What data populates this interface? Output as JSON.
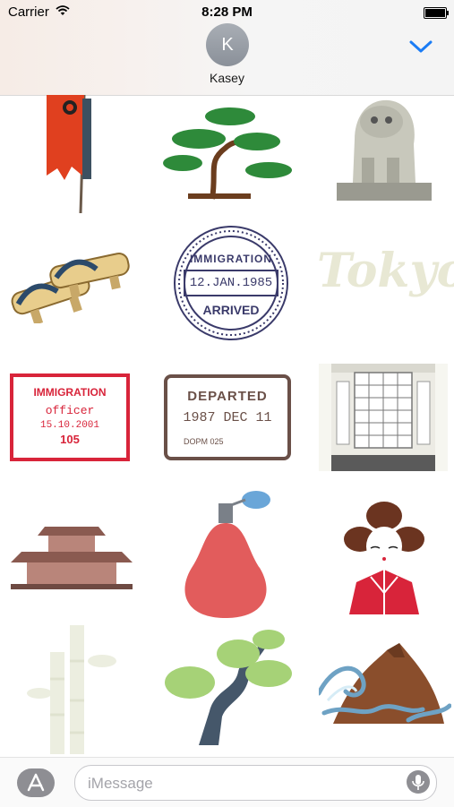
{
  "status_bar": {
    "carrier": "Carrier",
    "time": "8:28 PM"
  },
  "header": {
    "avatar_initial": "K",
    "contact_name": "Kasey",
    "chevron_icon": "chevron-down-icon",
    "accent_color": "#1a7cf5"
  },
  "stickers": {
    "stamp_immigration_arrived": {
      "line1": "IMMIGRATION",
      "date": "12.JAN.1985",
      "line2": "ARRIVED"
    },
    "tokyo_script": "Tokyo",
    "stamp_immigration_officer": {
      "line1": "IMMIGRATION",
      "line2": "officer",
      "date": "15.10.2001",
      "code": "105"
    },
    "stamp_departed": {
      "line1": "DEPARTED",
      "date": "1987 DEC 11",
      "code": "DOPM 025"
    }
  },
  "compose": {
    "placeholder": "iMessage",
    "app_store_icon": "app-store-icon",
    "mic_icon": "microphone-icon"
  }
}
